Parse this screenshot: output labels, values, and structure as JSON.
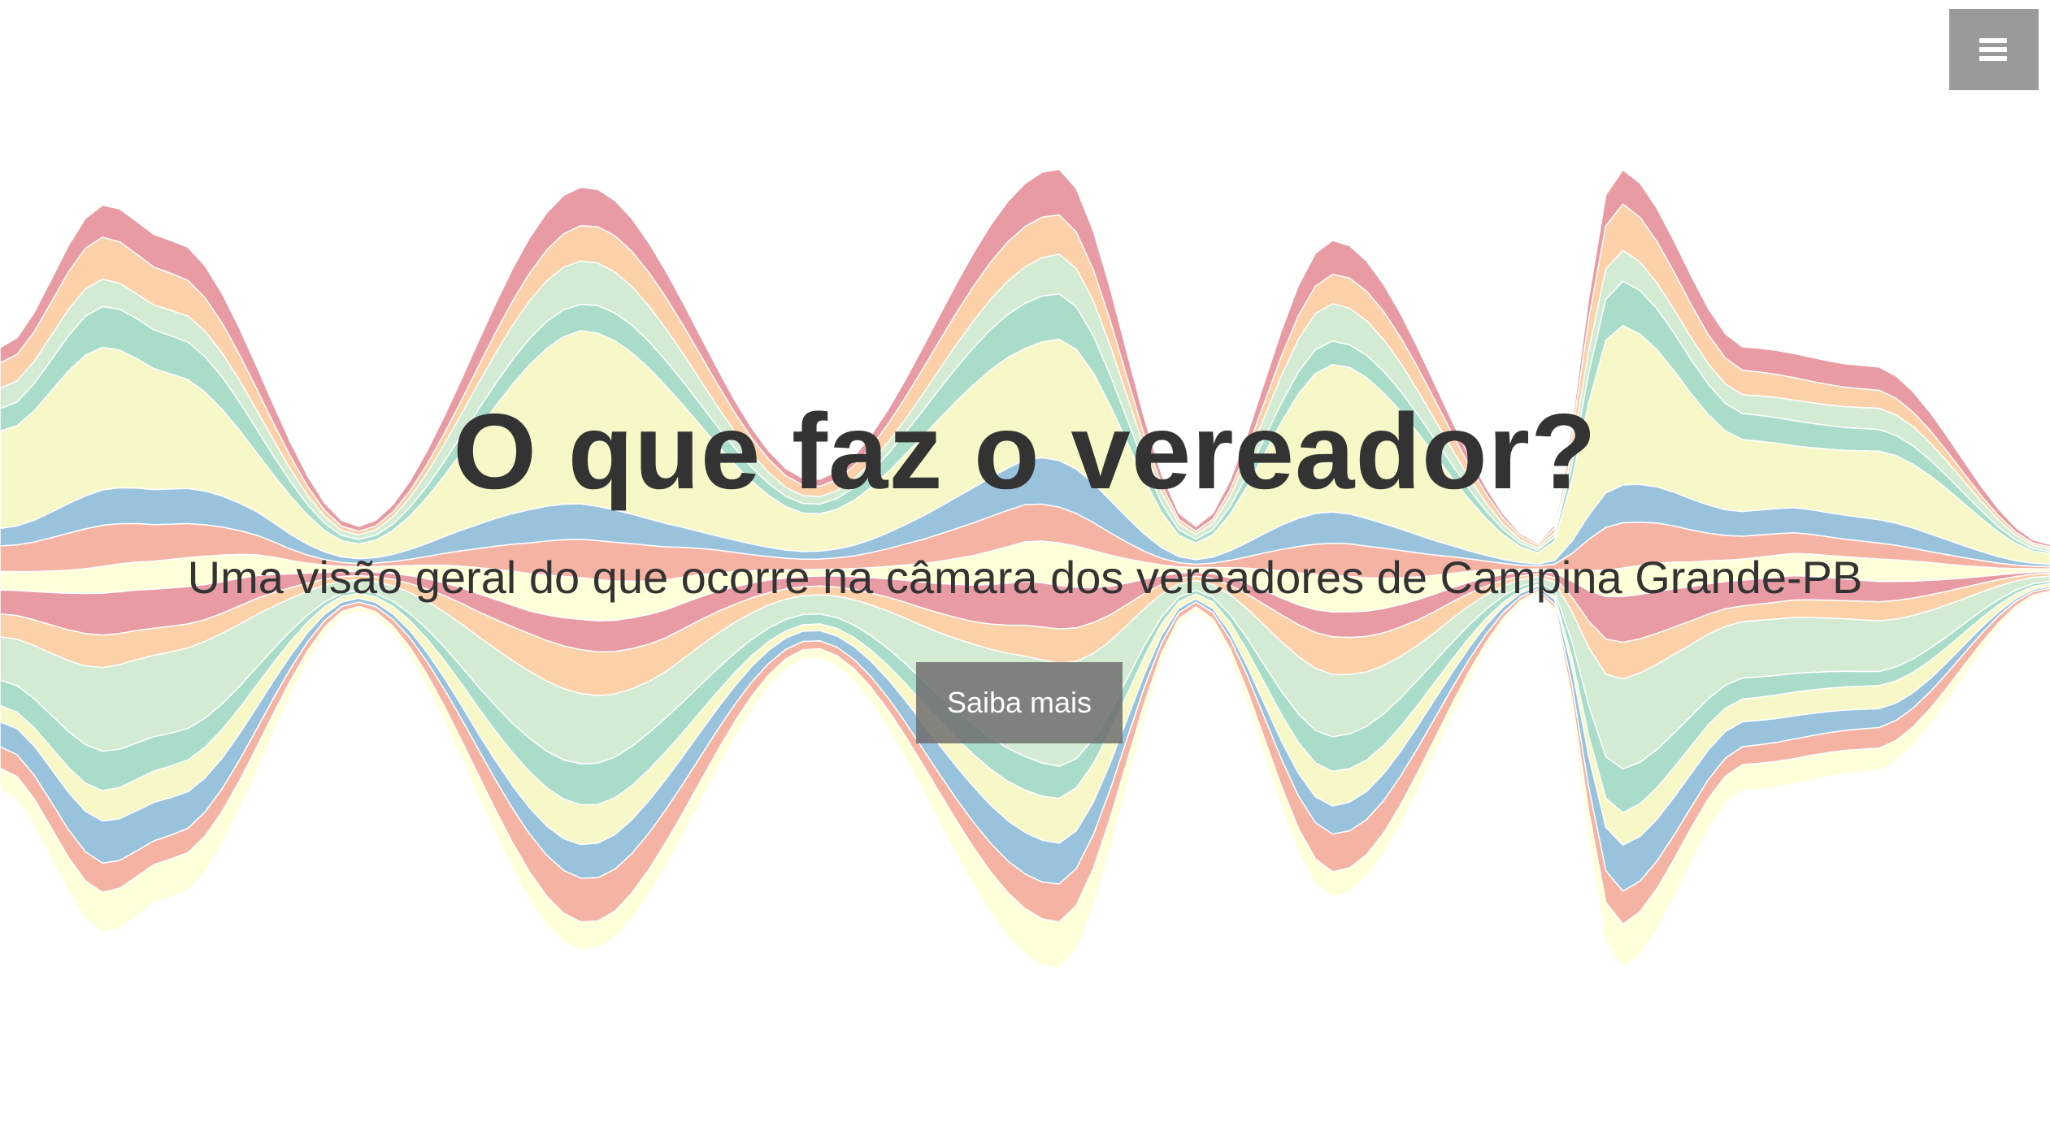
{
  "hero": {
    "title": "O que faz o vereador?",
    "subtitle": "Uma visão geral do que ocorre na câmara dos vereadores de Campina Grande-PB",
    "cta_label": "Saiba mais"
  },
  "menu": {
    "icon": "hamburger-menu-icon",
    "background_color": "#9a9a9a"
  },
  "streamgraph": {
    "palette": [
      "#e89ba3",
      "#fcd0a8",
      "#d3ebd2",
      "#a9dcc9",
      "#f7f7c8",
      "#99c2dd",
      "#f4b3a3",
      "#ffffd9"
    ]
  }
}
